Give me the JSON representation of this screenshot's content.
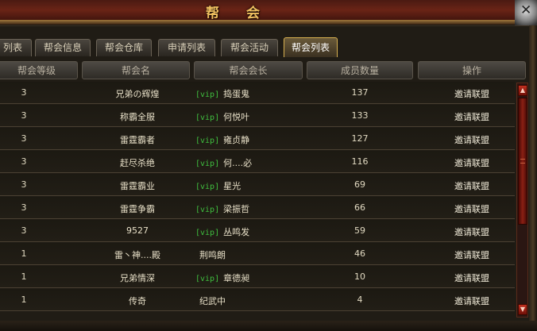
{
  "window": {
    "title": "帮 会"
  },
  "tabs": [
    {
      "label": "列表",
      "active": false
    },
    {
      "label": "帮会信息",
      "active": false
    },
    {
      "label": "帮会仓库",
      "active": false
    },
    {
      "label": "申请列表",
      "active": false
    },
    {
      "label": "帮会活动",
      "active": false
    },
    {
      "label": "帮会列表",
      "active": true
    }
  ],
  "columns": {
    "level": "帮会等级",
    "name": "帮会名",
    "leader": "帮会会长",
    "members": "成员数量",
    "action": "操作"
  },
  "rows": [
    {
      "level": "3",
      "name": "兄弟の辉煌",
      "vip": "[vip]",
      "leader": "捣蛋鬼",
      "members": "137",
      "action": "邀请联盟"
    },
    {
      "level": "3",
      "name": "称霸全服",
      "vip": "[vip]",
      "leader": "何悦叶",
      "members": "133",
      "action": "邀请联盟"
    },
    {
      "level": "3",
      "name": "雷霆霸者",
      "vip": "[vip]",
      "leader": "雍贞静",
      "members": "127",
      "action": "邀请联盟"
    },
    {
      "level": "3",
      "name": "赶尽杀绝",
      "vip": "[vip]",
      "leader": "何....必",
      "members": "116",
      "action": "邀请联盟"
    },
    {
      "level": "3",
      "name": "雷霆霸业",
      "vip": "[vip]",
      "leader": "星光",
      "members": "69",
      "action": "邀请联盟"
    },
    {
      "level": "3",
      "name": "雷霆争霸",
      "vip": "[vip]",
      "leader": "梁振哲",
      "members": "66",
      "action": "邀请联盟"
    },
    {
      "level": "3",
      "name": "9527",
      "vip": "[vip]",
      "leader": "丛鸣发",
      "members": "59",
      "action": "邀请联盟"
    },
    {
      "level": "1",
      "name": "雷丶神....殿",
      "vip": "",
      "leader": "荆鸣朗",
      "members": "46",
      "action": "邀请联盟"
    },
    {
      "level": "1",
      "name": "兄弟情深",
      "vip": "[vip]",
      "leader": "章德昶",
      "members": "10",
      "action": "邀请联盟"
    },
    {
      "level": "1",
      "name": "传奇",
      "vip": "",
      "leader": "纪武中",
      "members": "4",
      "action": "邀请联盟"
    }
  ],
  "icons": {
    "close": "close-icon",
    "scroll_up": "arrow-up-icon",
    "scroll_down": "arrow-down-icon"
  }
}
